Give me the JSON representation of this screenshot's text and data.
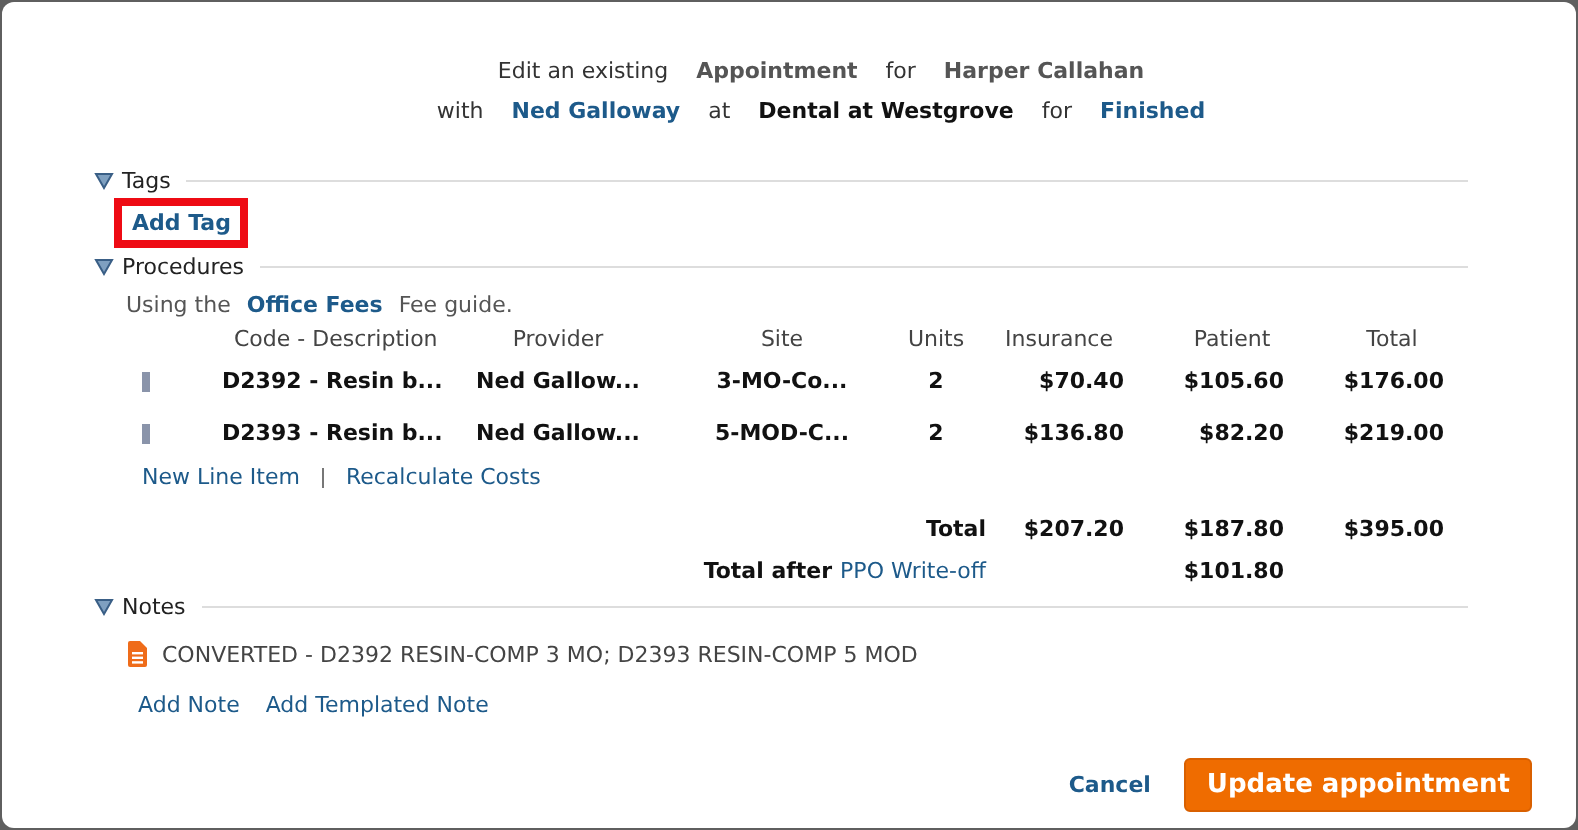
{
  "header": {
    "lines": [
      [
        {
          "text": "Edit an existing",
          "kind": "plain"
        },
        {
          "text": "Appointment",
          "kind": "bold"
        },
        {
          "text": "for",
          "kind": "plain"
        },
        {
          "text": "Harper Callahan",
          "kind": "bold"
        }
      ],
      [
        {
          "text": "with",
          "kind": "plain"
        },
        {
          "text": "Ned Galloway",
          "kind": "link"
        },
        {
          "text": "at",
          "kind": "plain"
        },
        {
          "text": "Dental at Westgrove",
          "kind": "strong"
        },
        {
          "text": "for",
          "kind": "plain"
        },
        {
          "text": "Finished",
          "kind": "link"
        }
      ]
    ]
  },
  "tags": {
    "title": "Tags",
    "expanded": true,
    "actions": [
      {
        "label": "Add Tag",
        "highlighted": true
      }
    ]
  },
  "procedures": {
    "title": "Procedures",
    "expanded": true,
    "fee_guide": {
      "prefix": "Using the",
      "name": "Office Fees",
      "suffix": "Fee guide."
    },
    "columns": [
      "Code - Description",
      "Provider",
      "Site",
      "Units",
      "Insurance",
      "Patient",
      "Total"
    ],
    "rows": [
      {
        "cells": [
          "D2392 - Resin b...",
          "Ned Gallow...",
          "3-MO-Co...",
          "2",
          "$70.40",
          "$105.60",
          "$176.00"
        ]
      },
      {
        "cells": [
          "D2393 - Resin b...",
          "Ned Gallow...",
          "5-MOD-C...",
          "2",
          "$136.80",
          "$82.20",
          "$219.00"
        ]
      }
    ],
    "links": [
      "New Line Item",
      "Recalculate Costs"
    ],
    "total": {
      "label": "Total",
      "insurance": "$207.20",
      "patient": "$187.80",
      "total": "$395.00"
    },
    "total_after": {
      "label": "Total after",
      "link": "PPO Write-off",
      "patient": "$101.80"
    }
  },
  "notes": {
    "title": "Notes",
    "expanded": true,
    "items": [
      {
        "text": "CONVERTED - D2392 RESIN-COMP 3 MO; D2393 RESIN-COMP 5 MOD"
      }
    ],
    "actions": [
      "Add Note",
      "Add Templated Note"
    ]
  },
  "footer": {
    "cancel": "Cancel",
    "submit": "Update appointment"
  }
}
